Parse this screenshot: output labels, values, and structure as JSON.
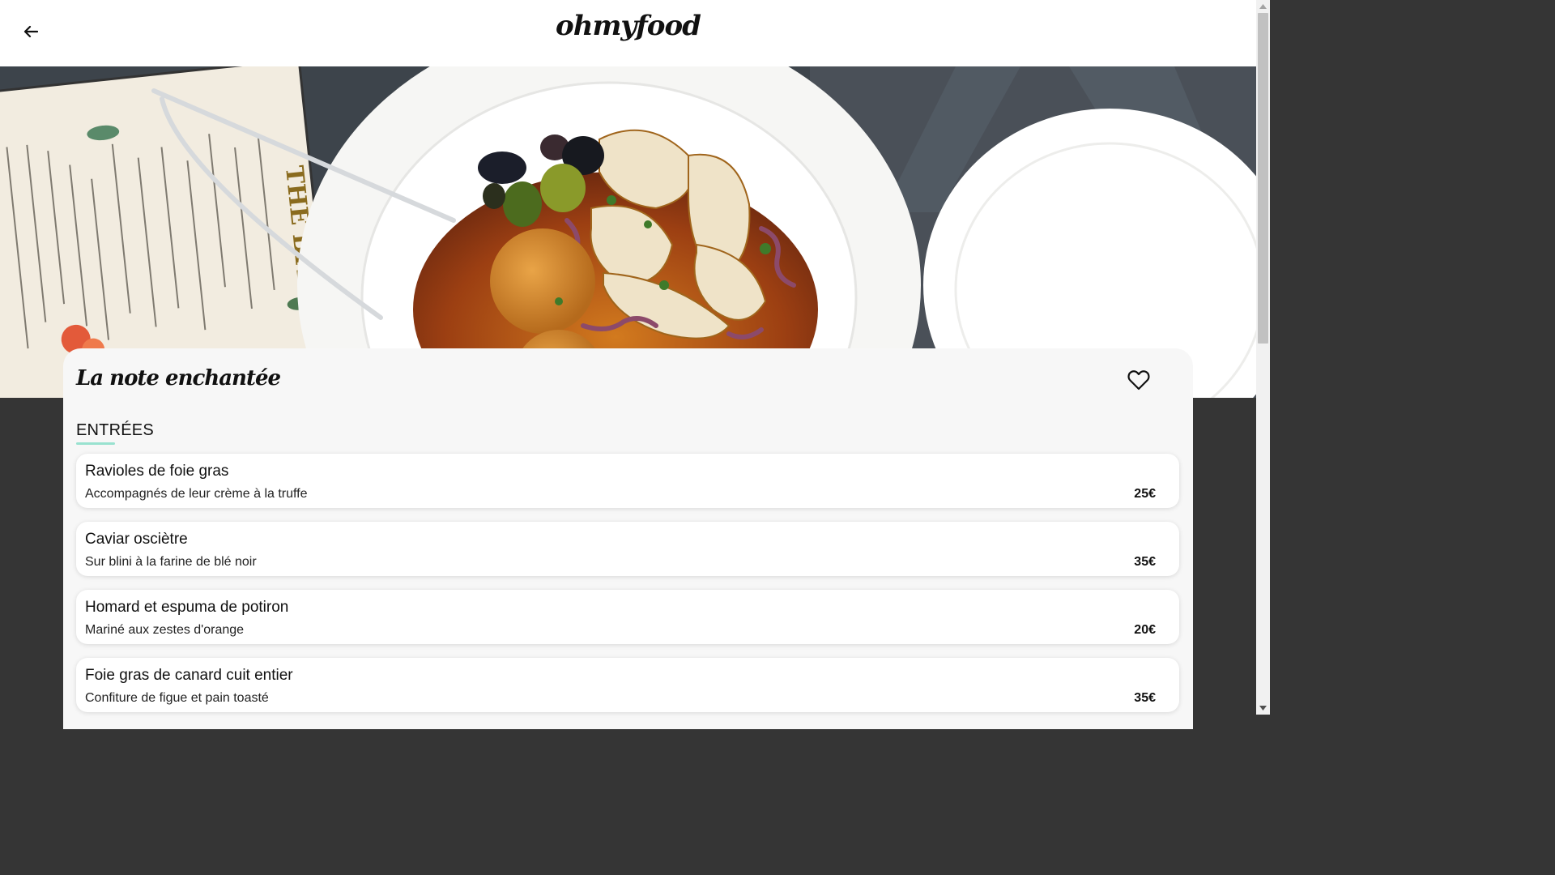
{
  "header": {
    "logo": "ohmyfood",
    "back_icon": "arrow-left-icon"
  },
  "restaurant": {
    "name": "La note enchantée",
    "favorite_icon": "heart-outline-icon"
  },
  "menu": {
    "section_title": "ENTRÉES",
    "accent_color": "#99e2d0",
    "dishes": [
      {
        "name": "Ravioles de foie gras",
        "description": "Accompagnés de leur crème à la truffe",
        "price": "25€"
      },
      {
        "name": "Caviar osciètre",
        "description": "Sur blini à la farine de blé noir",
        "price": "35€"
      },
      {
        "name": "Homard et espuma de potiron",
        "description": "Mariné aux zestes d'orange",
        "price": "20€"
      },
      {
        "name": "Foie gras de canard cuit entier",
        "description": "Confiture de figue et pain toasté",
        "price": "35€"
      }
    ]
  }
}
